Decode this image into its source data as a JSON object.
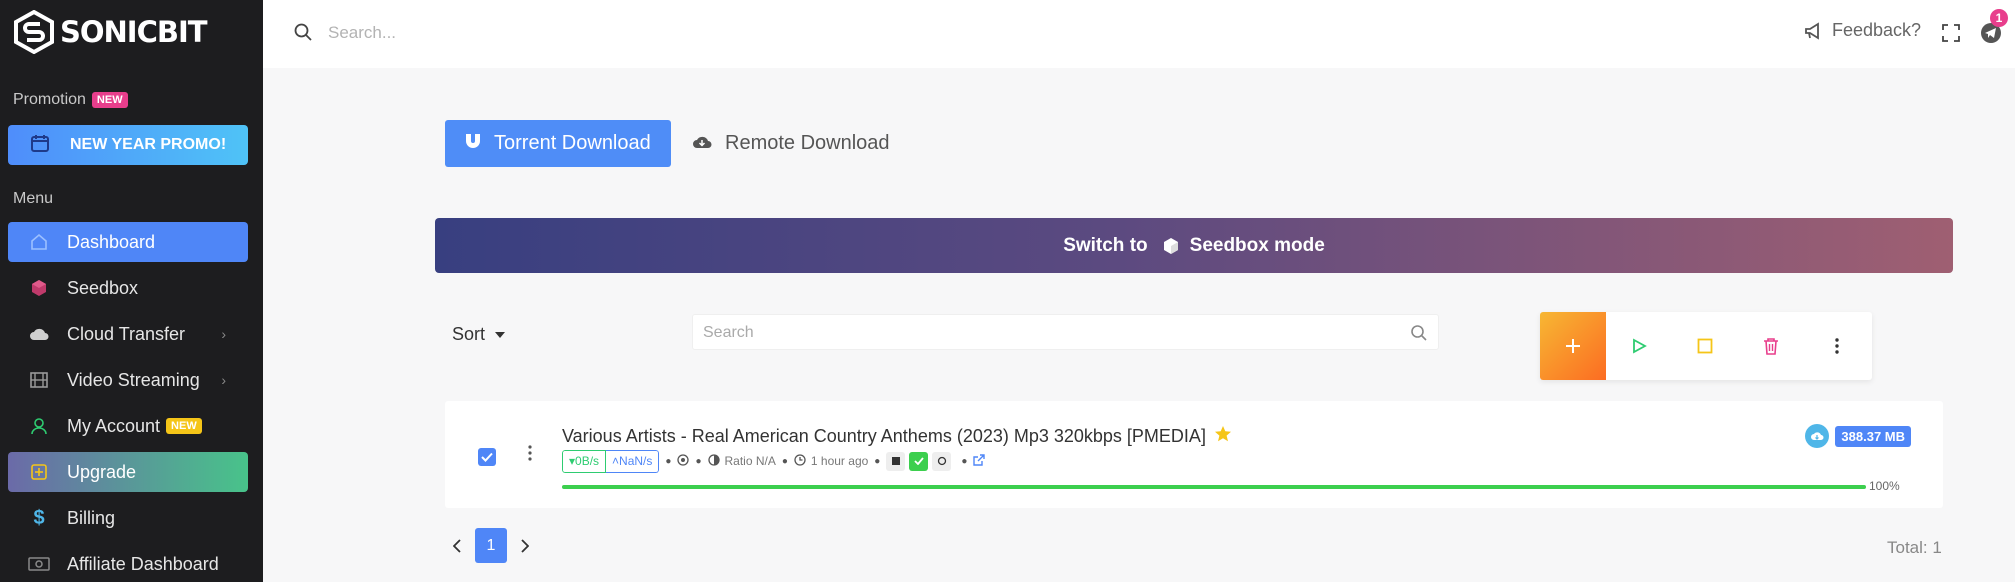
{
  "brand": {
    "name": "SONICBIT"
  },
  "sidebar": {
    "promotion_label": "Promotion",
    "promotion_badge": "NEW",
    "promo_button": "NEW YEAR PROMO!",
    "menu_label": "Menu",
    "items": [
      {
        "label": "Dashboard",
        "icon": "home-icon"
      },
      {
        "label": "Seedbox",
        "icon": "cube-icon"
      },
      {
        "label": "Cloud Transfer",
        "icon": "cloud-icon"
      },
      {
        "label": "Video Streaming",
        "icon": "film-icon"
      },
      {
        "label": "My Account",
        "icon": "user-icon",
        "badge": "NEW"
      },
      {
        "label": "Upgrade",
        "icon": "plus-square-icon"
      },
      {
        "label": "Billing",
        "icon": "dollar-icon"
      },
      {
        "label": "Affiliate Dashboard",
        "icon": "money-icon"
      }
    ]
  },
  "topbar": {
    "search_placeholder": "Search...",
    "feedback": "Feedback?",
    "notification_count": "1"
  },
  "downloads": {
    "tab_torrent": "Torrent Download",
    "tab_remote": "Remote Download",
    "switch_prefix": "Switch to",
    "switch_mode": "Seedbox mode",
    "sort_label": "Sort",
    "search_placeholder": "Search"
  },
  "torrent": {
    "title": "Various Artists - Real American Country Anthems (2023) Mp3 320kbps [PMEDIA]",
    "down_speed": "▾0B/s",
    "up_speed": "˄NaN/s",
    "ratio": "Ratio N/A",
    "added": "1 hour ago",
    "size": "388.37 MB",
    "progress": 100,
    "progress_label": "100%"
  },
  "pagination": {
    "current": "1",
    "total_label": "Total: 1"
  },
  "colors": {
    "primary": "#4f86f7",
    "success": "#3ccf4e",
    "danger": "#e83e8c",
    "warning": "#f5c518"
  }
}
